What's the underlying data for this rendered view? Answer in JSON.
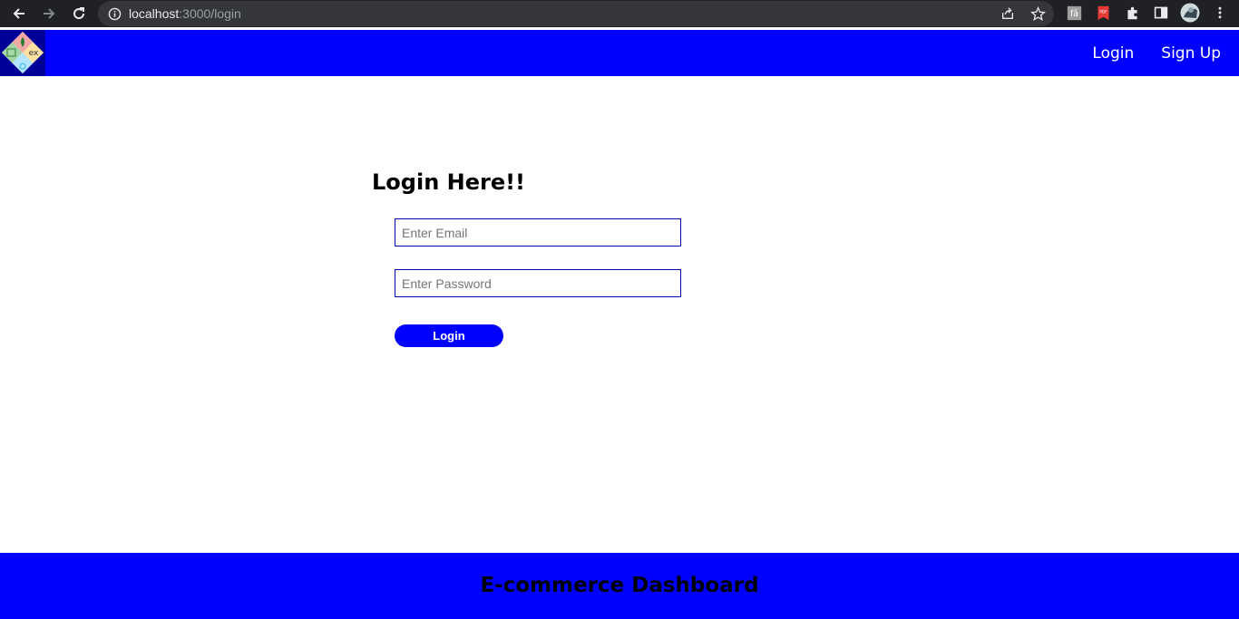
{
  "browser": {
    "url_host": "localhost",
    "url_path": ":3000/login"
  },
  "nav": {
    "login_label": "Login",
    "signup_label": "Sign Up",
    "logo_text": "ex"
  },
  "login": {
    "title": "Login Here!!",
    "email_placeholder": "Enter Email",
    "email_value": "",
    "password_placeholder": "Enter Password",
    "password_value": "",
    "button_label": "Login"
  },
  "footer": {
    "title": "E-commerce Dashboard"
  },
  "colors": {
    "brand_blue": "#0000ff",
    "logo_bg": "#000099",
    "browser_dark": "#202124"
  }
}
